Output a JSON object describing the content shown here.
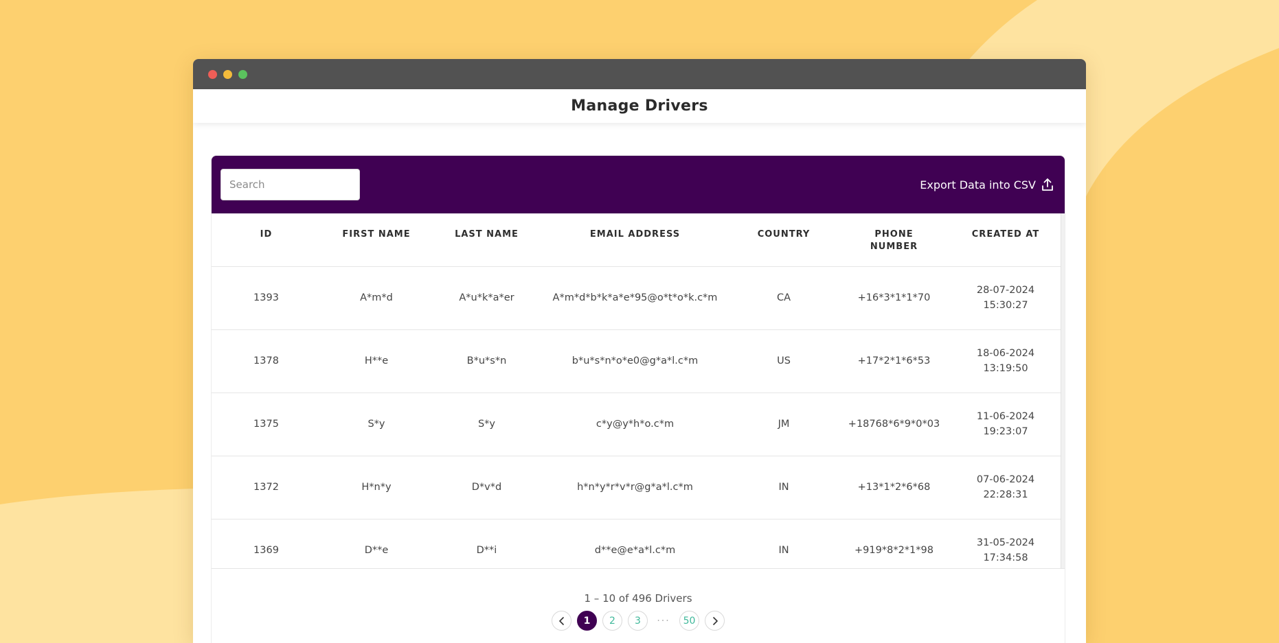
{
  "page": {
    "title": "Manage Drivers"
  },
  "toolbar": {
    "search_placeholder": "Search",
    "export_label": "Export Data into CSV",
    "export_icon": "upload-icon"
  },
  "colors": {
    "background": "#fdd06f",
    "toolbar": "#400153",
    "titlebar": "#525252",
    "page_active": "#400153",
    "page_link": "#3fb89a"
  },
  "table": {
    "headers": [
      "ID",
      "FIRST NAME",
      "LAST NAME",
      "EMAIL ADDRESS",
      "COUNTRY",
      "PHONE NUMBER",
      "CREATED AT"
    ],
    "rows": [
      {
        "id": "1393",
        "first": "A*m*d",
        "last": "A*u*k*a*er",
        "email": "A*m*d*b*k*a*e*95@o*t*o*k.c*m",
        "country": "CA",
        "phone": "+16*3*1*1*70",
        "date": "28-07-2024",
        "time": "15:30:27"
      },
      {
        "id": "1378",
        "first": "H**e",
        "last": "B*u*s*n",
        "email": "b*u*s*n*o*e0@g*a*l.c*m",
        "country": "US",
        "phone": "+17*2*1*6*53",
        "date": "18-06-2024",
        "time": "13:19:50"
      },
      {
        "id": "1375",
        "first": "S*y",
        "last": "S*y",
        "email": "c*y@y*h*o.c*m",
        "country": "JM",
        "phone": "+18768*6*9*0*03",
        "date": "11-06-2024",
        "time": "19:23:07"
      },
      {
        "id": "1372",
        "first": "H*n*y",
        "last": "D*v*d",
        "email": "h*n*y*r*v*r@g*a*l.c*m",
        "country": "IN",
        "phone": "+13*1*2*6*68",
        "date": "07-06-2024",
        "time": "22:28:31"
      },
      {
        "id": "1369",
        "first": "D**e",
        "last": "D**i",
        "email": "d**e@e*a*l.c*m",
        "country": "IN",
        "phone": "+919*8*2*1*98",
        "date": "31-05-2024",
        "time": "17:34:58"
      }
    ]
  },
  "pagination": {
    "summary": "1 – 10  of  496 Drivers",
    "pages": [
      "1",
      "2",
      "3"
    ],
    "ellipsis": "···",
    "last_page": "50",
    "current": "1",
    "prev_icon": "chevron-left-icon",
    "next_icon": "chevron-right-icon"
  }
}
